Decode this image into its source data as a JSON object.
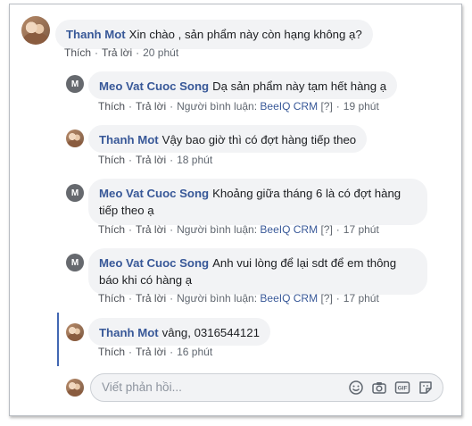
{
  "comments": [
    {
      "author": "Thanh Mot",
      "text": "Xin chào , sản phẩm này còn hạng không ạ?",
      "like": "Thích",
      "reply": "Trả lời",
      "time": "20 phút"
    },
    {
      "author": "Meo Vat Cuoc Song",
      "text": "Dạ sản phẩm này tạm hết hàng ạ",
      "avatar_letter": "M",
      "like": "Thích",
      "reply": "Trả lời",
      "commenter_label": "Người bình luận: ",
      "crm": "BeeIQ CRM",
      "flag": "[?]",
      "time": "19 phút"
    },
    {
      "author": "Thanh Mot",
      "text": "Vậy bao giờ thì có đợt hàng tiếp theo",
      "like": "Thích",
      "reply": "Trả lời",
      "time": "18 phút"
    },
    {
      "author": "Meo Vat Cuoc Song",
      "text": "Khoảng giữa tháng 6 là có đợt hàng tiếp theo ạ",
      "avatar_letter": "M",
      "like": "Thích",
      "reply": "Trả lời",
      "commenter_label": "Người bình luận: ",
      "crm": "BeeIQ CRM",
      "flag": "[?]",
      "time": "17 phút"
    },
    {
      "author": "Meo Vat Cuoc Song",
      "text": "Anh vui lòng để lại sdt để em thông báo khi có hàng ạ",
      "avatar_letter": "M",
      "like": "Thích",
      "reply": "Trả lời",
      "commenter_label": "Người bình luận: ",
      "crm": "BeeIQ CRM",
      "flag": "[?]",
      "time": "17 phút"
    },
    {
      "author": "Thanh Mot",
      "text": "vâng, 0316544121",
      "like": "Thích",
      "reply": "Trả lời",
      "time": "16 phút"
    }
  ],
  "reply_box": {
    "placeholder": "Viết phản hồi...",
    "icons": [
      "emoji-icon",
      "camera-icon",
      "gif-icon",
      "sticker-icon"
    ],
    "gif_label": "GIF"
  },
  "colors": {
    "name": "#385898",
    "bubble": "#f2f3f5",
    "thread": "#4267b2"
  }
}
